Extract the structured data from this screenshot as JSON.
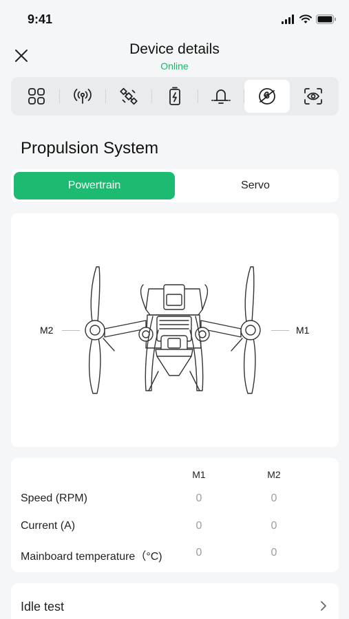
{
  "status_bar": {
    "time": "9:41",
    "icons": [
      "signal-icon",
      "wifi-icon",
      "battery-icon"
    ]
  },
  "header": {
    "title": "Device details",
    "subtitle": "Online",
    "close_icon": "close-icon"
  },
  "tabs": [
    {
      "icon": "grid-icon",
      "active": false
    },
    {
      "icon": "antenna-icon",
      "active": false
    },
    {
      "icon": "satellite-icon",
      "active": false
    },
    {
      "icon": "battery-bolt-icon",
      "active": false
    },
    {
      "icon": "bell-icon",
      "active": false
    },
    {
      "icon": "propeller-icon",
      "active": true
    },
    {
      "icon": "camera-scan-icon",
      "active": false
    }
  ],
  "section_title": "Propulsion System",
  "segments": [
    {
      "label": "Powertrain",
      "active": true
    },
    {
      "label": "Servo",
      "active": false
    }
  ],
  "diagram": {
    "left_label": "M2",
    "right_label": "M1"
  },
  "table": {
    "columns": [
      "M1",
      "M2"
    ],
    "rows": [
      {
        "label": "Speed (RPM)",
        "m1": "0",
        "m2": "0"
      },
      {
        "label": "Current (A)",
        "m1": "0",
        "m2": "0"
      },
      {
        "label": "Mainboard temperature（°C)",
        "m1": "0",
        "m2": "0"
      }
    ]
  },
  "idle_test": {
    "label": "Idle test"
  },
  "colors": {
    "accent": "#1dbb72",
    "online": "#19b46a",
    "background": "#f5f6f7"
  }
}
